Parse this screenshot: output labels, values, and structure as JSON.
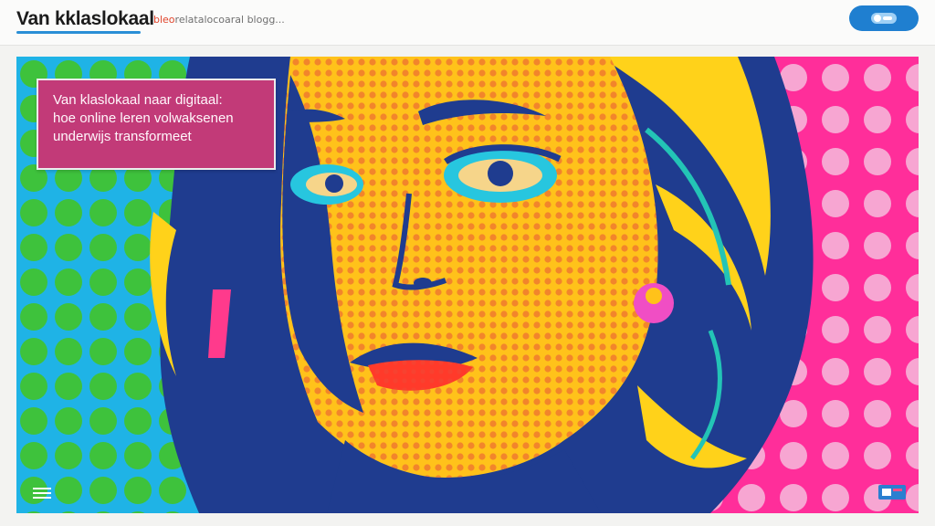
{
  "header": {
    "brand": "Van kklaslokaal",
    "tagline_accent": "bleo",
    "tagline_rest": "relatalocoaral blogg..."
  },
  "hero": {
    "title_lines": [
      "Van klaslokaal naar digitaal:",
      "hoe online leren volwaksenen",
      "underwijs transformeet"
    ]
  },
  "colors": {
    "brand_underline": "#2a8fd6",
    "button": "#1f7fd0",
    "title_card": "#c23a78",
    "bg_cyan": "#1fb3e6",
    "dots_green": "#3ec23c",
    "bg_pink": "#ff2e9a",
    "face_yellow": "#ffc21a",
    "hair_navy": "#1f3c8f",
    "lips_red": "#ff3a2a"
  },
  "icons": [
    "menu-lines-icon",
    "toggle-icon",
    "widget-icon"
  ]
}
